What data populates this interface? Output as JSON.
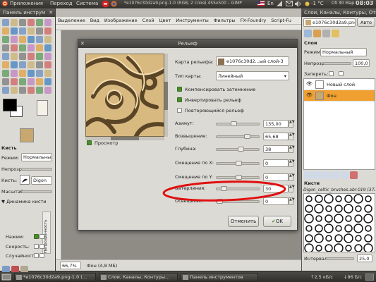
{
  "top_panel": {
    "apps": "Приложения",
    "places": "Переход",
    "system": "Система",
    "window_title": "*e1076c30d2a9.png-1.0 (RGB, 2 слоя) 455x500 – GIMP",
    "lang": "En",
    "temp": "-1 °C",
    "date": "Сб 30 Мар",
    "time": "08:03"
  },
  "toolbox": {
    "title": "Панель инструм",
    "brush_header": "Кисть",
    "mode_label": "Режим:",
    "mode_value": "Нормальный",
    "opacity_label": "Непрозр.:",
    "brush_label": "Кисть:",
    "brush_value": "Digon",
    "scale_label": "Масштаб:",
    "dynamics_label": "Динамика кисти",
    "pressure_label": "Нажим:",
    "velocity_label": "Скорость:",
    "random_label": "Случайность:",
    "side_opacity": "Непрозрачность",
    "side_size": "Размер"
  },
  "image_window": {
    "menus": [
      "Выделение",
      "Вид",
      "Изображение",
      "Слой",
      "Цвет",
      "Инструменты",
      "Фильтры",
      "FX-Foundry",
      "Script-Fu"
    ],
    "zoom": "66,7%",
    "status": "Фон (4,8 МБ)"
  },
  "dialog": {
    "title": "Рельеф",
    "bump_map_label": "Карта рельефа:",
    "bump_map_value": "e1076c30d2...ый слой-3",
    "map_type_label": "Тип карты:",
    "map_type_value": "Линейный",
    "compensate_label": "Компенсировать затемнение",
    "compensate_checked": true,
    "invert_label": "Инвертировать рельеф",
    "invert_checked": true,
    "tile_label": "Повторяющийся рельеф",
    "tile_checked": false,
    "preview_label": "Просмотр",
    "preview_checked": true,
    "azimuth_label": "Азимут:",
    "azimuth_value": "135,00",
    "azimuth_level": 0.375,
    "elevation_label": "Возвышение:",
    "elevation_value": "65,68",
    "elevation_level": 0.73,
    "depth_label": "Глубина:",
    "depth_value": "38",
    "depth_level": 0.57,
    "xoffset_label": "Смещение по X:",
    "xoffset_value": "0",
    "xoffset_level": 0.5,
    "yoffset_label": "Смещение по Y:",
    "yoffset_value": "0",
    "yoffset_level": 0.5,
    "waterlevel_label": "Ватерлиния:",
    "waterlevel_value": "30",
    "waterlevel_level": 0.12,
    "ambient_label": "Освещение:",
    "ambient_value": "0",
    "ambient_level": 0.0,
    "cancel_label": "Отменить",
    "ok_label": "OK"
  },
  "layers_window": {
    "title": "Слои, Каналы, Контуры, Отм",
    "image_selector": "e1076c30d2a9.png-1",
    "auto_label": "Авто",
    "layers_tab": "Слои",
    "mode_label": "Режим:",
    "mode_value": "Нормальный",
    "opacity_label": "Непрозр.:",
    "opacity_value": "100,0",
    "lock_label": "Запереть:",
    "layers": [
      {
        "name": "Новый слой",
        "selected": false
      },
      {
        "name": "Фон",
        "selected": true
      }
    ],
    "brushes_header": "Кисти",
    "brush_name": "Digon_celtic_brushes.abr-019 (373 ×",
    "spacing_label": "Интервал:",
    "spacing_value": "25,0"
  },
  "taskbar": {
    "items": [
      "*e1076c30d2a9.png-1.0 (…",
      "Слои, Каналы, Контуры…",
      "Панель инструментов"
    ],
    "upload": "2,5 кБ/с",
    "download": "96 Б/с"
  },
  "colors": {
    "accent_green": "#4a8f2a",
    "annotation_red": "#e01010",
    "selection_orange": "#f0a030"
  }
}
